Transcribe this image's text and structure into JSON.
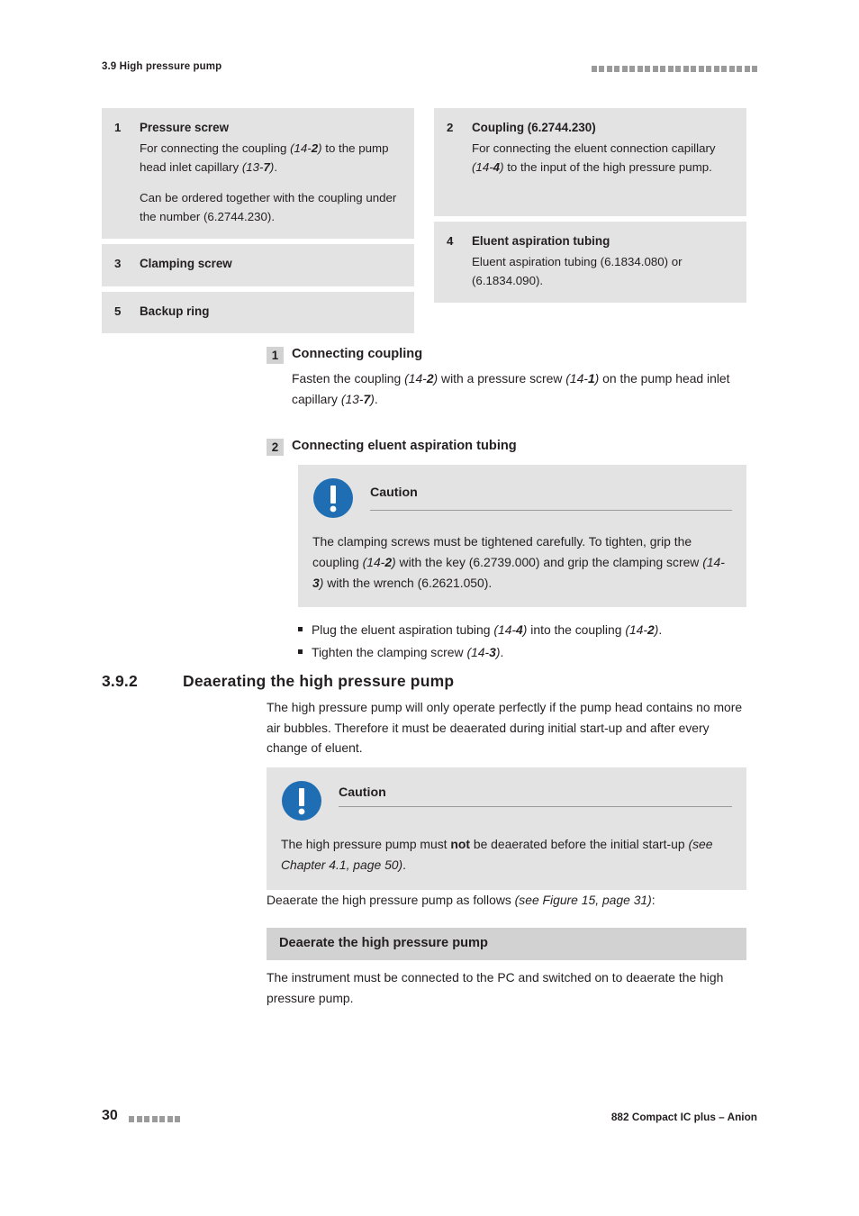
{
  "header": {
    "left": "3.9 High pressure pump",
    "block_count": 22
  },
  "legend": {
    "left_column": [
      {
        "num": "1",
        "title": "Pressure screw",
        "paragraphs": [
          "For connecting the coupling (14-2) to the pump head inlet capillary (13-7).",
          "Can be ordered together with the coupling under the number (6.2744.230)."
        ]
      },
      {
        "num": "3",
        "title": "Clamping screw",
        "paragraphs": []
      },
      {
        "num": "5",
        "title": "Backup ring",
        "paragraphs": []
      }
    ],
    "right_column": [
      {
        "num": "2",
        "title": "Coupling (6.2744.230)",
        "paragraphs": [
          "For connecting the eluent connection capillary (14-4) to the input of the high pressure pump."
        ]
      },
      {
        "num": "4",
        "title": "Eluent aspiration tubing",
        "paragraphs": [
          "Eluent aspiration tubing (6.1834.080) or (6.1834.090)."
        ]
      }
    ]
  },
  "step1": {
    "badge": "1",
    "title": "Connecting coupling",
    "body": "Fasten the coupling (14-2) with a pressure screw (14-1) on the pump head inlet capillary (13-7)."
  },
  "step2": {
    "badge": "2",
    "title": "Connecting eluent aspiration tubing",
    "caution": {
      "title": "Caution",
      "icon": "exclamation-circle-icon",
      "icon_color": "#1f6eb4",
      "text": "The clamping screws must be tightened carefully. To tighten, grip the coupling (14-2) with the key (6.2739.000) and grip the clamping screw (14-3) with the wrench (6.2621.050)."
    },
    "bullets": [
      "Plug the eluent aspiration tubing (14-4) into the coupling (14-2).",
      "Tighten the clamping screw (14-3)."
    ]
  },
  "section": {
    "number": "3.9.2",
    "title": "Deaerating the high pressure pump",
    "intro": "The high pressure pump will only operate perfectly if the pump head contains no more air bubbles. Therefore it must be deaerated during initial start-up and after every change of eluent.",
    "caution": {
      "title": "Caution",
      "icon": "exclamation-circle-icon",
      "text": "The high pressure pump must not be deaerated before the initial start-up (see Chapter 4.1, page 50)."
    },
    "after_caution": "Deaerate the high pressure pump as follows (see Figure 15, page 31):",
    "graybar": "Deaerate the high pressure pump",
    "closing": "The instrument must be connected to the PC and switched on to deaerate the high pressure pump."
  },
  "footer": {
    "page": "30",
    "block_count": 7,
    "right": "882 Compact IC plus – Anion"
  }
}
